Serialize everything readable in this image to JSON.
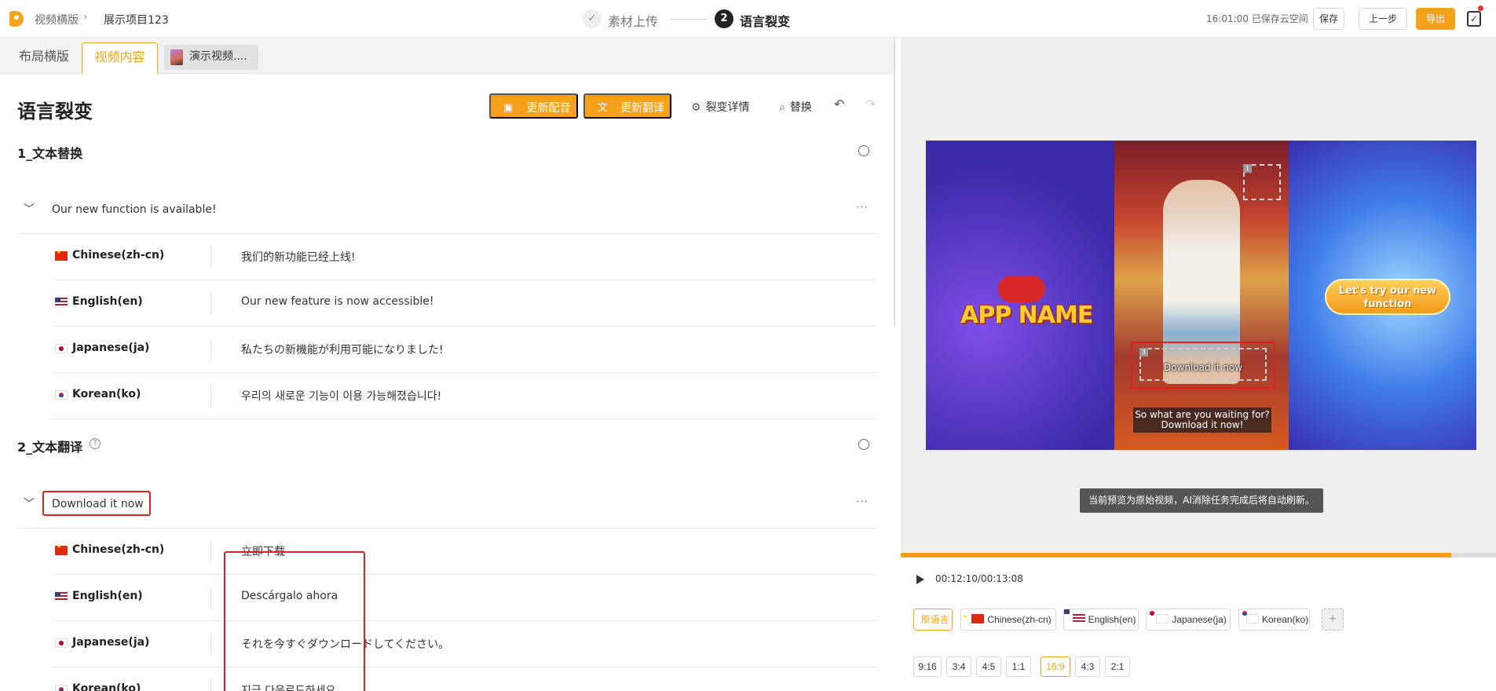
{
  "topbar": {
    "breadcrumb_root": "视频横版",
    "breadcrumb_sep": "›",
    "breadcrumb_project": "展示项目123",
    "step1_icon": "✓",
    "step1_label": "素材上传",
    "step2_number": "2",
    "step2_label": "语言裂变",
    "save_status": "16:01:00 已保存云空间",
    "save_label": "保存",
    "prev_label": "上一步",
    "export_label": "导出",
    "accent_color": "#f7a11a"
  },
  "tabs": {
    "layout": "布局横版",
    "content": "视频内容",
    "demo": "演示视频...."
  },
  "editor": {
    "title": "语言裂变",
    "update_dub": "更新配音",
    "update_translate": "更新翻译",
    "details": "裂变详情",
    "replace": "替换",
    "undo_icon": "↶",
    "redo_icon": "↷"
  },
  "groups": [
    {
      "title": "1_文本替换",
      "source": "Our new function is available!",
      "rows": [
        {
          "lang": "Chinese(zh-cn)",
          "flag": "cn",
          "text": "我们的新功能已经上线!"
        },
        {
          "lang": "English(en)",
          "flag": "us",
          "text": "Our new feature is now accessible!"
        },
        {
          "lang": "Japanese(ja)",
          "flag": "jp",
          "text": "私たちの新機能が利用可能になりました!"
        },
        {
          "lang": "Korean(ko)",
          "flag": "kr",
          "text": "우리의 새로운 기능이 이용 가능해졌습니다!"
        }
      ]
    },
    {
      "title": "2_文本翻译",
      "help_icon": "?",
      "source": "Download it now",
      "rows": [
        {
          "lang": "Chinese(zh-cn)",
          "flag": "cn",
          "text": "立即下载"
        },
        {
          "lang": "English(en)",
          "flag": "us",
          "text": "Descárgalo ahora"
        },
        {
          "lang": "Japanese(ja)",
          "flag": "jp",
          "text": "それを今すぐダウンロードしてください。"
        },
        {
          "lang": "Korean(ko)",
          "flag": "kr",
          "text": "지금 다운로드하세요"
        }
      ]
    }
  ],
  "preview": {
    "app_name": "APP NAME",
    "cta": "Let's try our new function",
    "download_text": "Download it now",
    "subtitle": "So what are you waiting for? Download it now!",
    "box1_num": "1",
    "box3_num": "3",
    "toast": "当前预览为原始视频，AI消除任务完成后将自动刷新。",
    "time": "00:12:10/00:13:08",
    "progress": 0.925
  },
  "languages": {
    "original": "原语言",
    "chips": [
      {
        "label": "Chinese(zh-cn)",
        "flag": "cn"
      },
      {
        "label": "English(en)",
        "flag": "us"
      },
      {
        "label": "Japanese(ja)",
        "flag": "jp"
      },
      {
        "label": "Korean(ko)",
        "flag": "kr"
      }
    ],
    "add": "+"
  },
  "ratios": [
    "9:16",
    "3:4",
    "4:5",
    "1:1",
    "16:9",
    "4:3",
    "2:1"
  ],
  "active_ratio": "16:9"
}
